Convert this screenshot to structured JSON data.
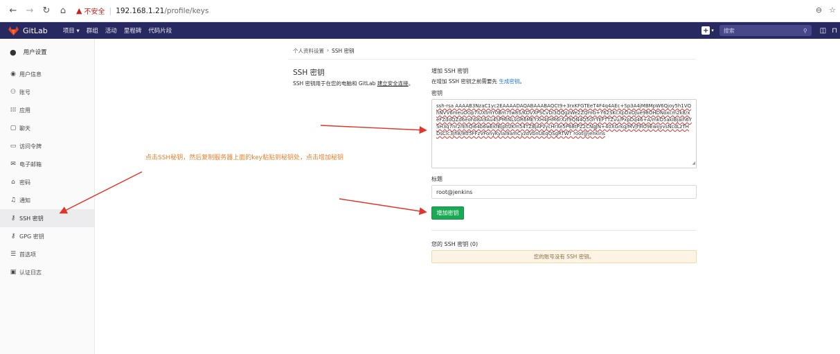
{
  "browser": {
    "insecure_label": "不安全",
    "url_host": "192.168.1.21",
    "url_path": "/profile/keys"
  },
  "header": {
    "brand": "GitLab",
    "nav": [
      "项目 ▾",
      "群组",
      "活动",
      "里程碑",
      "代码片段"
    ],
    "search_placeholder": "搜索"
  },
  "sidebar": {
    "context_title": "用户设置",
    "items": [
      {
        "label": "用户信息",
        "icon": "user-circle-icon"
      },
      {
        "label": "账号",
        "icon": "users-icon"
      },
      {
        "label": "应用",
        "icon": "grid-icon"
      },
      {
        "label": "聊天",
        "icon": "chat-icon"
      },
      {
        "label": "访问令牌",
        "icon": "token-icon"
      },
      {
        "label": "电子邮箱",
        "icon": "envelope-icon"
      },
      {
        "label": "密码",
        "icon": "lock-icon"
      },
      {
        "label": "通知",
        "icon": "bell-icon"
      },
      {
        "label": "SSH 密钥",
        "icon": "key-icon"
      },
      {
        "label": "GPG 密钥",
        "icon": "key-icon"
      },
      {
        "label": "首选项",
        "icon": "sliders-icon"
      },
      {
        "label": "认证日志",
        "icon": "log-icon"
      }
    ],
    "active_index": 8
  },
  "breadcrumb": {
    "parent": "个人资料设置",
    "separator": "›",
    "current": "SSH 密钥"
  },
  "left_panel": {
    "title": "SSH 密钥",
    "desc_prefix": "SSH 密钥用于在您的电脑和 GitLab ",
    "desc_link": "建立安全连接",
    "desc_suffix": "。"
  },
  "form": {
    "title": "增加 SSH 密钥",
    "hint_prefix": "在增加 SSH 密钥之前需要先 ",
    "hint_link": "生成密钥",
    "hint_suffix": "。",
    "key_label": "密钥",
    "key_value": "ssh-rsa AAAAB3NzaC1yc2EAAAADAQABAAABAQCt9+3rxKFGTEeT4F4q4AEc+Sp3A4jMBMpW6Qjoy5h1VQhNVV6meuOGp7lUXtmY0Bm7tw8S/KDVXPSCvDi3QQgzWe2ZQmG+Y62SKcXpDxOJue98OHDNoxcm2k8/xeFZddQZd6eohb8A9Au4SPMINLsGR6MEYXH4JHM6rXzf9QN4Q5GYYEFTTZvu/PxpDq46+A/mkO5akIBjaih6YSH3q7nr2rEhQi64b6wEkfBjptfzKm54TZBJAPzycHrXe5P68tPZ2CNgJN+40XGrkq/MVjf9lO9EwijyvsNcdLzTHDsClc3Jh8/8tf5FFzVFonyKyIal9amCyzdVbnUEqQSgRTWT root@jenkins",
    "title_label": "标题",
    "title_value": "root@jenkins",
    "add_button": "增加密钥",
    "your_keys": "您的 SSH 密钥 (0)",
    "empty_message": "您的账号没有 SSH 密钥。"
  },
  "annotation": {
    "text": "点击SSH秘钥，然后复制服务器上面的key粘贴到秘钥处，点击增加秘钥",
    "color": "#e8812f",
    "arrow_color": "#e0352b"
  },
  "colors": {
    "header_bg": "#292961",
    "button_green": "#1aaa55",
    "link_blue": "#1f78d1"
  }
}
